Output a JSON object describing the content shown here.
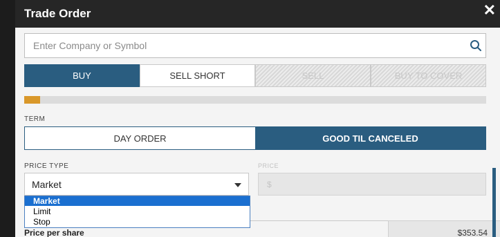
{
  "dialog": {
    "title": "Trade Order",
    "close_label": "✕"
  },
  "search": {
    "placeholder": "Enter Company or Symbol",
    "value": ""
  },
  "action_tabs": [
    {
      "label": "BUY",
      "selected": true,
      "enabled": true
    },
    {
      "label": "SELL SHORT",
      "selected": false,
      "enabled": true
    },
    {
      "label": "SELL",
      "selected": false,
      "enabled": false
    },
    {
      "label": "BUY TO COVER",
      "selected": false,
      "enabled": false
    }
  ],
  "progress": {
    "fraction": 0.035,
    "color": "#d9982a"
  },
  "term": {
    "label": "TERM",
    "options": [
      {
        "label": "DAY ORDER",
        "selected": false
      },
      {
        "label": "GOOD TIL CANCELED",
        "selected": true
      }
    ]
  },
  "price_type": {
    "label": "PRICE TYPE",
    "value": "Market",
    "options": [
      "Market",
      "Limit",
      "Stop"
    ],
    "highlighted": "Market"
  },
  "price": {
    "label": "PRICE",
    "prefix": "$",
    "disabled": true
  },
  "price_per_share": {
    "label": "Price per share",
    "value": "$353.54"
  },
  "colors": {
    "primary": "#2a5d80",
    "titlebar": "#262626",
    "accent": "#d9982a",
    "dropdown_highlight": "#1a6fd0"
  }
}
